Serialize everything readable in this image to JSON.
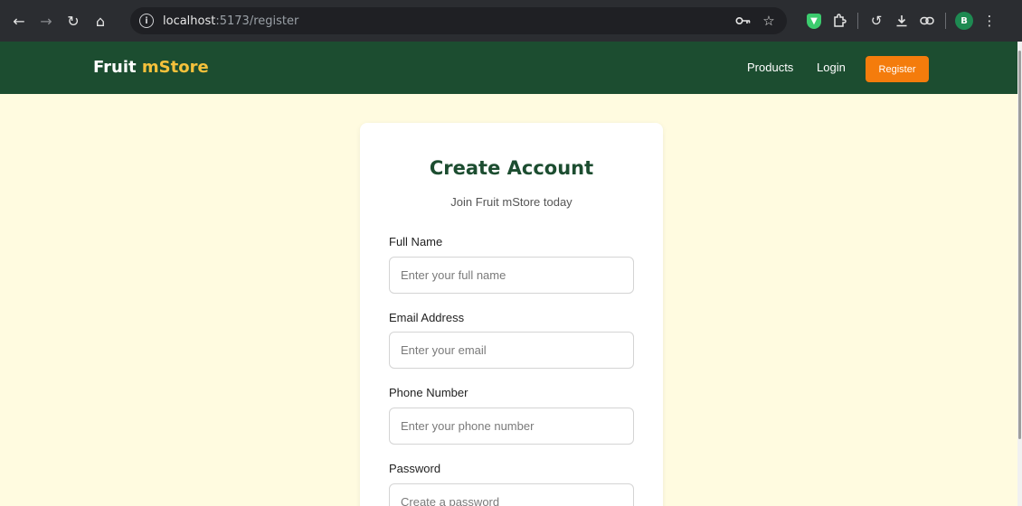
{
  "browser": {
    "url_host": "localhost",
    "url_path": ":5173/register",
    "profile_initial": "B"
  },
  "navbar": {
    "brand_primary": "Fruit",
    "brand_accent": "mStore",
    "links": {
      "products": "Products",
      "login": "Login",
      "register": "Register"
    }
  },
  "form": {
    "title": "Create Account",
    "subtitle": "Join Fruit mStore today",
    "fields": {
      "full_name": {
        "label": "Full Name",
        "placeholder": "Enter your full name",
        "value": ""
      },
      "email": {
        "label": "Email Address",
        "placeholder": "Enter your email",
        "value": ""
      },
      "phone": {
        "label": "Phone Number",
        "placeholder": "Enter your phone number",
        "value": ""
      },
      "password": {
        "label": "Password",
        "placeholder": "Create a password",
        "value": ""
      }
    }
  },
  "colors": {
    "navbar_bg": "#1c4d30",
    "brand_accent": "#f5c13b",
    "register_button": "#f47c0c",
    "page_bg": "#fffbe0",
    "title": "#1c4d30"
  },
  "icons": {
    "back": "back-arrow-icon",
    "forward": "forward-arrow-icon",
    "reload": "reload-icon",
    "home": "home-icon",
    "site_info": "info-icon",
    "password_key": "key-icon",
    "bookmark": "star-icon",
    "extension_shield": "shield-icon",
    "extensions": "puzzle-icon",
    "history": "history-icon",
    "download": "download-icon",
    "link": "link-icon",
    "menu": "kebab-menu-icon"
  }
}
